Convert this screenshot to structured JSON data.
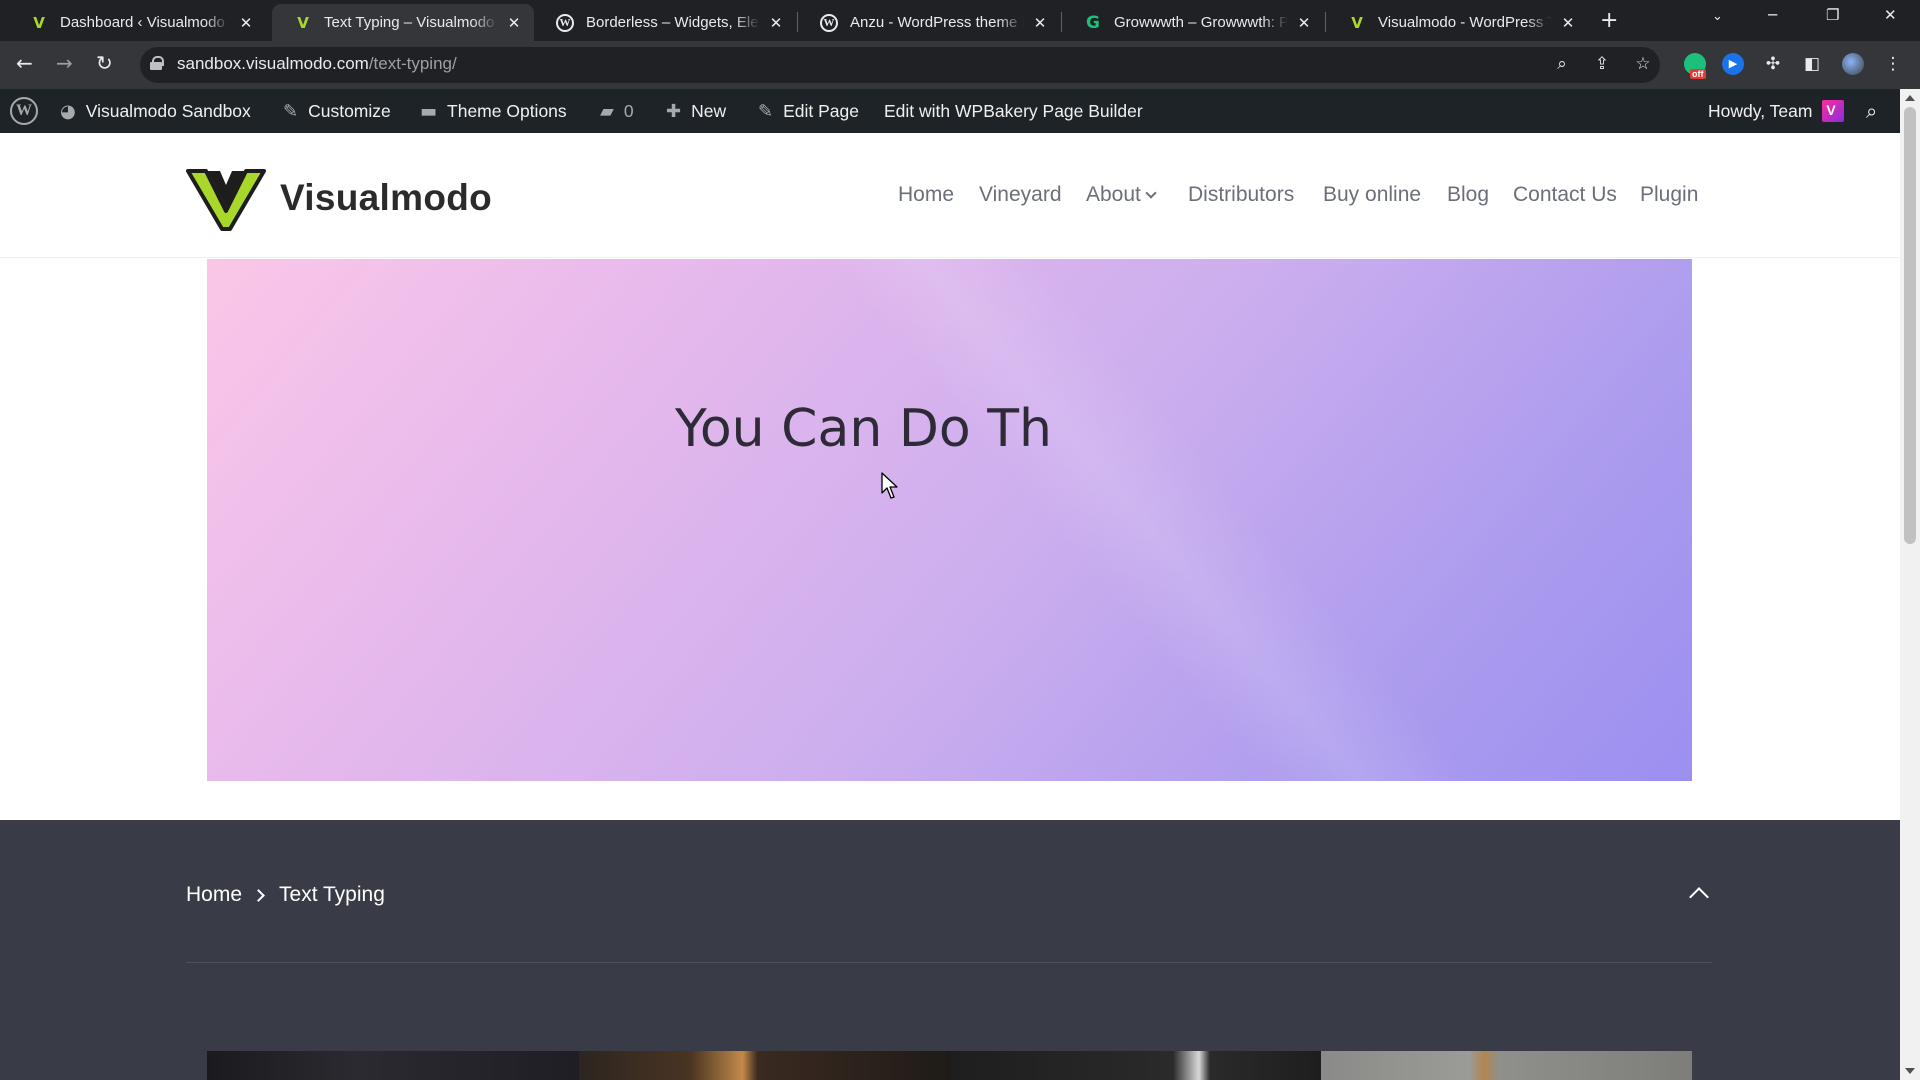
{
  "browser": {
    "tabs": [
      {
        "title": "Dashboard ‹ Visualmodo Sandbox",
        "favicon": "visualmodo-icon",
        "active": false
      },
      {
        "title": "Text Typing – Visualmodo Sandbox",
        "favicon": "visualmodo-icon",
        "active": true
      },
      {
        "title": "Borderless – Widgets, Elements",
        "favicon": "wordpress-icon",
        "active": false
      },
      {
        "title": "Anzu - WordPress theme | Visualmodo",
        "favicon": "wordpress-icon",
        "active": false
      },
      {
        "title": "Growwwth – Growwwth: Pr",
        "favicon": "growwwth-icon",
        "active": false
      },
      {
        "title": "Visualmodo - WordPress Themes",
        "favicon": "visualmodo-icon",
        "active": false
      }
    ],
    "close_glyph": "✕",
    "new_tab_glyph": "+",
    "url_host": "sandbox.visualmodo.com",
    "url_path": "/text-typing/",
    "extension_badge": "off"
  },
  "adminbar": {
    "site_name": "Visualmodo Sandbox",
    "customize": "Customize",
    "theme_options": "Theme Options",
    "comments_count": "0",
    "new": "New",
    "edit_page": "Edit Page",
    "edit_with": "Edit with WPBakery Page Builder",
    "howdy": "Howdy, Team"
  },
  "site": {
    "logo_text": "Visualmodo",
    "nav": {
      "home": "Home",
      "vineyard": "Vineyard",
      "about": "About",
      "distributors": "Distributors",
      "buy_online": "Buy online",
      "blog": "Blog",
      "contact": "Contact Us",
      "plugin": "Plugin"
    }
  },
  "hero": {
    "typed_text": "You Can Do Th",
    "gradient_start": "#fbc7e8",
    "gradient_end": "#9b8ff0"
  },
  "breadcrumb": {
    "home": "Home",
    "current": "Text Typing"
  },
  "colors": {
    "tab_strip": "#202124",
    "toolbar": "#35363a",
    "adminbar": "#1d2327",
    "logo_accent": "#a8d82a",
    "dark_band": "#393c47"
  }
}
